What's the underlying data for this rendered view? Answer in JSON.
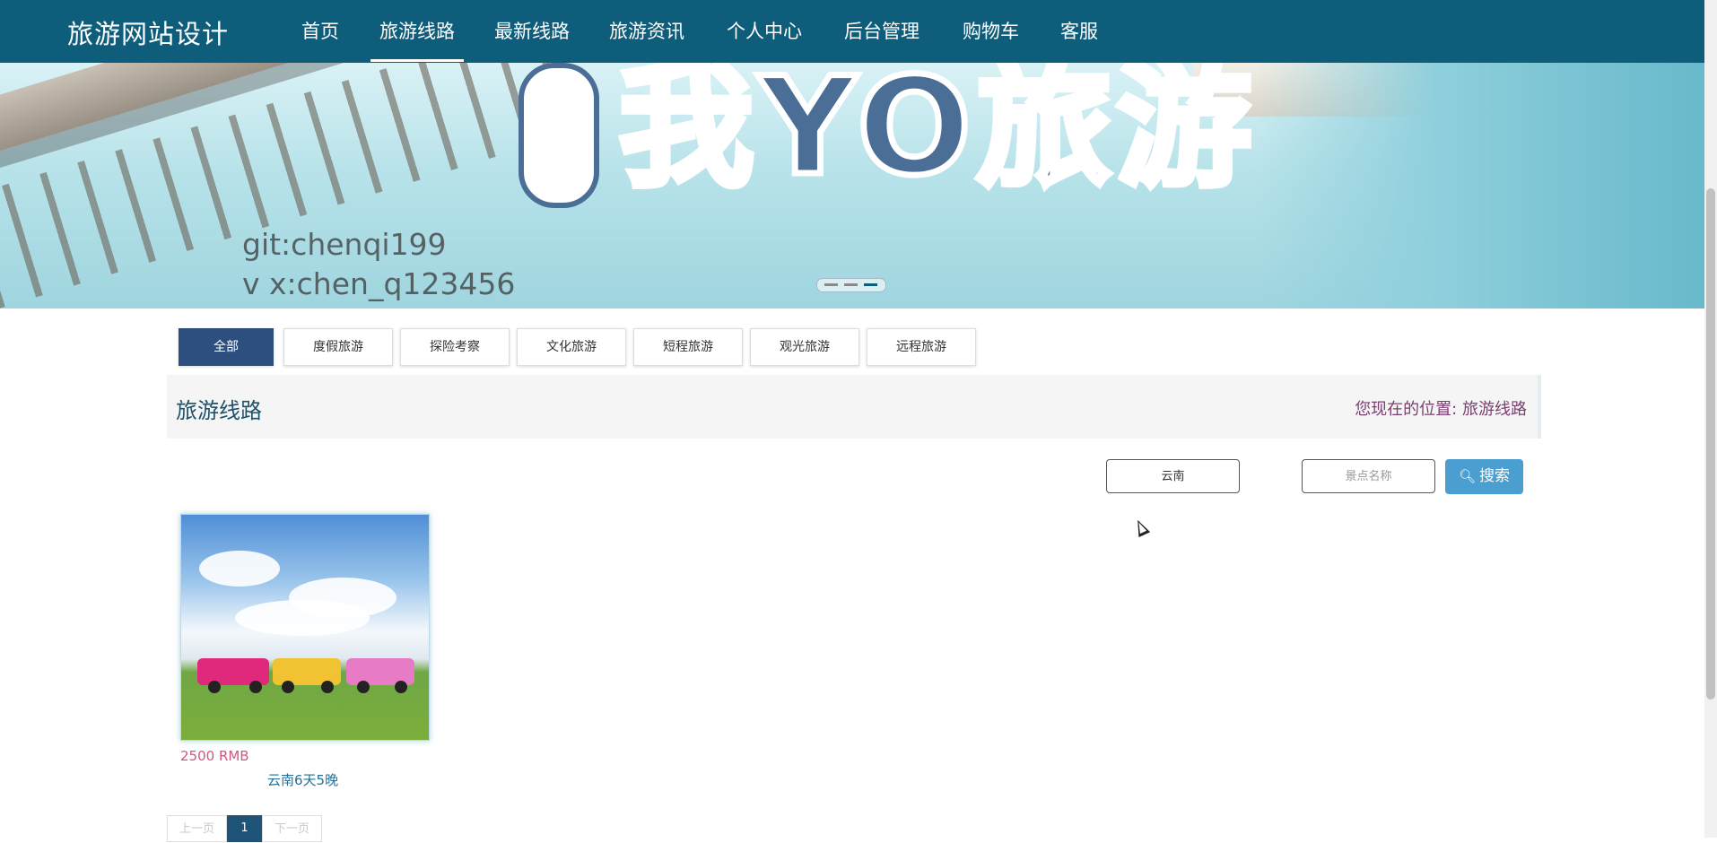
{
  "nav": {
    "brand": "旅游网站设计",
    "items": [
      "首页",
      "旅游线路",
      "最新线路",
      "旅游资讯",
      "个人中心",
      "后台管理",
      "购物车",
      "客服"
    ],
    "active_index": 1
  },
  "banner": {
    "logo_text": "我YO旅游",
    "watermark_line1": "git:chenqi199",
    "watermark_line2": "v x:chen_q123456",
    "slide_count": 3,
    "active_slide": 3
  },
  "categories": [
    "全部",
    "度假旅游",
    "探险考察",
    "文化旅游",
    "短程旅游",
    "观光旅游",
    "远程旅游"
  ],
  "active_category": 0,
  "section": {
    "title": "旅游线路",
    "breadcrumb_prefix": "您现在的位置:",
    "breadcrumb_current": "旅游线路"
  },
  "search": {
    "region_value": "云南",
    "name_placeholder": "景点名称",
    "button_label": "搜索"
  },
  "routes": [
    {
      "price": "2500 RMB",
      "name": "云南6天5晚"
    }
  ],
  "pagination": {
    "prev_label": "上一页",
    "current_page": "1",
    "next_label": "下一页"
  },
  "colors": {
    "nav_bg": "#0e5d7b",
    "active_category": "#2c4f80",
    "search_button": "#4a9fd0",
    "price": "#d0577f"
  }
}
